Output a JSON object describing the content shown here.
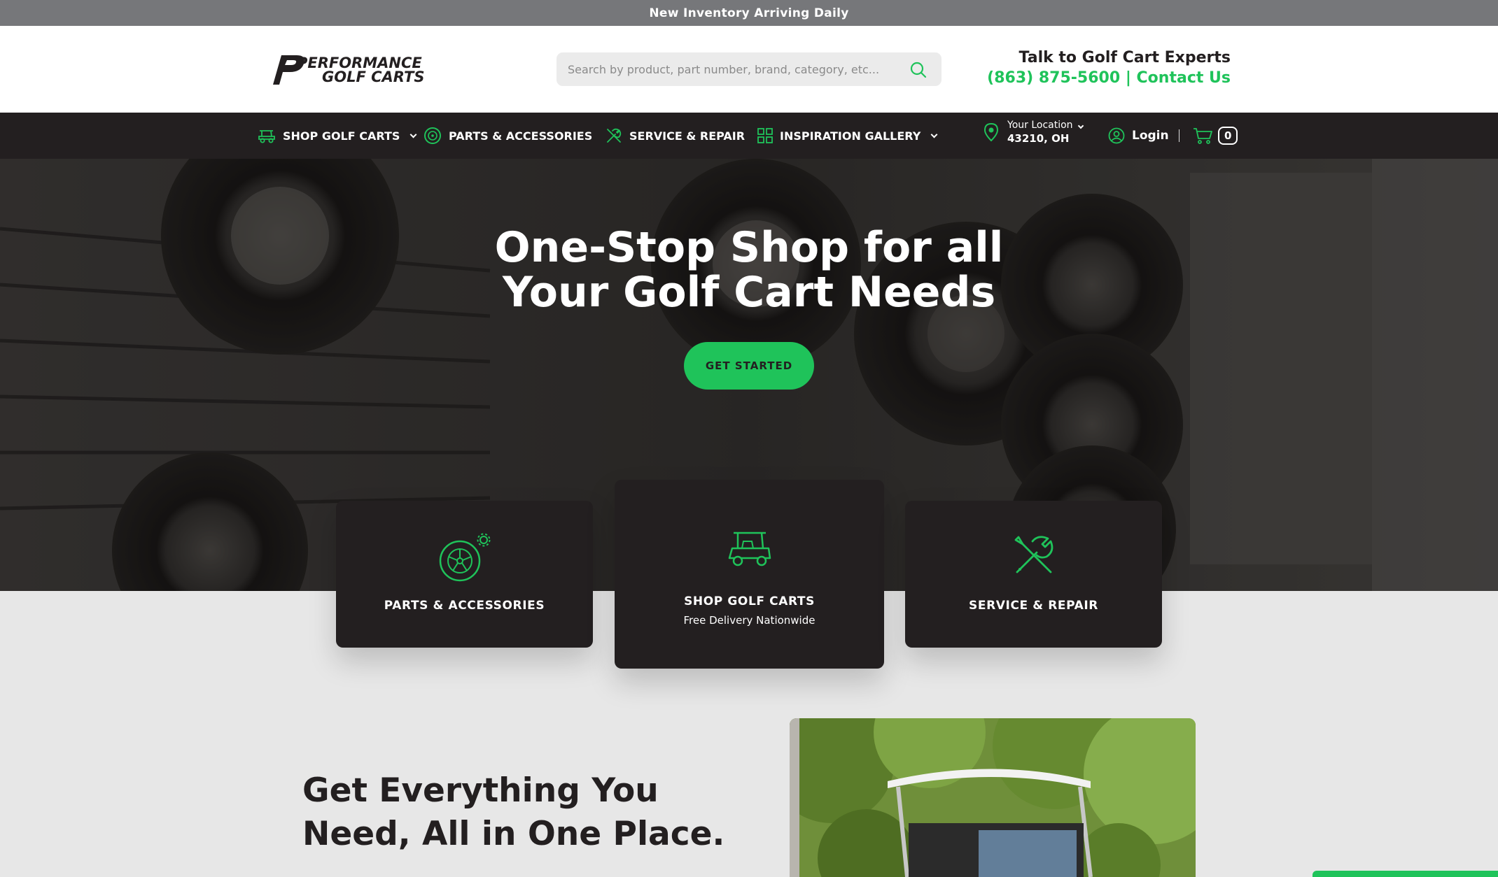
{
  "announcement": "New Inventory Arriving Daily",
  "header": {
    "logo_text_1": "PERFORMANCE",
    "logo_text_2": "GOLF CARTS",
    "search_placeholder": "Search by product, part number, brand, category, etc...",
    "experts_title": "Talk to Golf Cart Experts",
    "phone": "(863) 875-5600",
    "separator": "|",
    "contact_label": "Contact Us"
  },
  "nav": {
    "items": [
      {
        "label": "SHOP GOLF CARTS",
        "icon": "golf-cart-icon",
        "dropdown": true
      },
      {
        "label": "PARTS & ACCESSORIES",
        "icon": "wheel-icon",
        "dropdown": false
      },
      {
        "label": "SERVICE & REPAIR",
        "icon": "tools-icon",
        "dropdown": false
      },
      {
        "label": "INSPIRATION GALLERY",
        "icon": "grid-icon",
        "dropdown": true
      }
    ],
    "location_label": "Your Location",
    "location_value": "43210, OH",
    "login_label": "Login",
    "cart_count": "0"
  },
  "hero": {
    "title_line1": "One-Stop Shop for all",
    "title_line2": "Your Golf Cart Needs",
    "cta_label": "GET STARTED"
  },
  "cards": [
    {
      "title": "PARTS & ACCESSORIES",
      "subtitle": "",
      "icon": "wheel-gear-icon"
    },
    {
      "title": "SHOP GOLF CARTS",
      "subtitle": "Free Delivery Nationwide",
      "icon": "golf-cart-icon"
    },
    {
      "title": "SERVICE & REPAIR",
      "subtitle": "",
      "icon": "tools-icon"
    }
  ],
  "feature": {
    "title_line1": "Get Everything You",
    "title_line2": "Need, All in One Place."
  },
  "colors": {
    "accent": "#1fc35a",
    "dark": "#231f20",
    "announce_bg": "#76777a",
    "page_bg": "#e7e7e7"
  }
}
